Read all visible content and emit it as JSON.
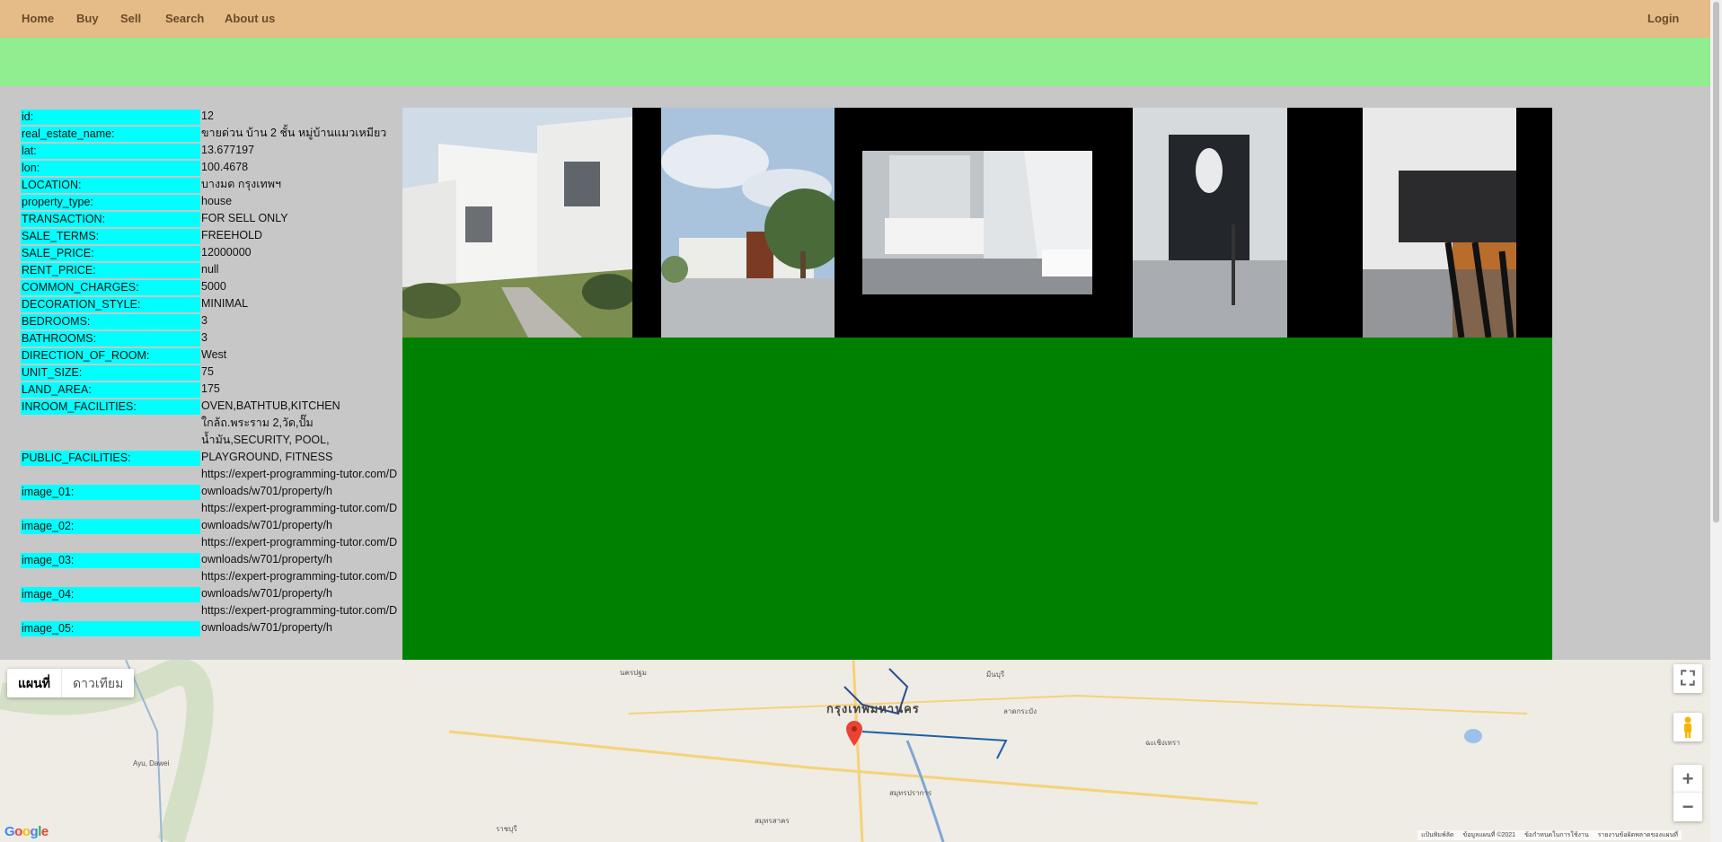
{
  "nav": {
    "items": [
      "Home",
      "Buy",
      "Sell",
      "Search",
      "About us"
    ],
    "login": "Login"
  },
  "property": [
    {
      "key": "id:",
      "value": "12"
    },
    {
      "key": "real_estate_name:",
      "value": "ขายด่วน บ้าน 2 ชั้น หมู่บ้านแมวเหมียว"
    },
    {
      "key": "lat:",
      "value": "13.677197"
    },
    {
      "key": "lon:",
      "value": "100.4678"
    },
    {
      "key": "LOCATION:",
      "value": "บางมด กรุงเทพฯ"
    },
    {
      "key": "property_type:",
      "value": "house"
    },
    {
      "key": "TRANSACTION:",
      "value": "FOR SELL ONLY"
    },
    {
      "key": "SALE_TERMS:",
      "value": "FREEHOLD"
    },
    {
      "key": "SALE_PRICE:",
      "value": "12000000"
    },
    {
      "key": "RENT_PRICE:",
      "value": "null"
    },
    {
      "key": "COMMON_CHARGES:",
      "value": "5000"
    },
    {
      "key": "DECORATION_STYLE:",
      "value": "MINIMAL"
    },
    {
      "key": "BEDROOMS:",
      "value": "3"
    },
    {
      "key": "BATHROOMS:",
      "value": "3"
    },
    {
      "key": "DIRECTION_OF_ROOM:",
      "value": "West"
    },
    {
      "key": "UNIT_SIZE:",
      "value": "75"
    },
    {
      "key": "LAND_AREA:",
      "value": "175"
    },
    {
      "key": "INROOM_FACILITIES:",
      "value": "OVEN,BATHTUB,KITCHEN"
    },
    {
      "key": "PUBLIC_FACILITIES:",
      "value": "ใกล้ถ.พระราม 2,วัด,ปั๊มน้ำมัน,SECURITY, POOL, PLAYGROUND, FITNESS"
    },
    {
      "key": "image_01:",
      "value": "https://expert-programming-tutor.com/Downloads/w701/property/h"
    },
    {
      "key": "image_02:",
      "value": "https://expert-programming-tutor.com/Downloads/w701/property/h"
    },
    {
      "key": "image_03:",
      "value": "https://expert-programming-tutor.com/Downloads/w701/property/h"
    },
    {
      "key": "image_04:",
      "value": "https://expert-programming-tutor.com/Downloads/w701/property/h"
    },
    {
      "key": "image_05:",
      "value": "https://expert-programming-tutor.com/Downloads/w701/property/h"
    }
  ],
  "map": {
    "map_button": "แผนที่",
    "satellite_button": "ดาวเทียม",
    "city_label": "กรุงเทพมหานคร",
    "place_labels": [
      "นครปฐม",
      "สมุทรสาคร",
      "สมุทรปราการ",
      "ราชบุรี",
      "ฉะเชิงเทรา",
      "Ayu, Dawei",
      "ลาดกระบัง",
      "มีนบุรี"
    ],
    "footer": [
      "แป้นพิมพ์ลัด",
      "ข้อมูลแผนที่ ©2021",
      "ข้อกำหนดในการใช้งาน",
      "รายงานข้อผิดพลาดของแผนที่"
    ],
    "google": "Google"
  },
  "colors": {
    "nav_bg": "#e5bb87",
    "green_bar": "#90ee90",
    "key_bg": "#00ffff",
    "gallery_bg": "#008000",
    "page_bg": "#c7c7c7"
  }
}
